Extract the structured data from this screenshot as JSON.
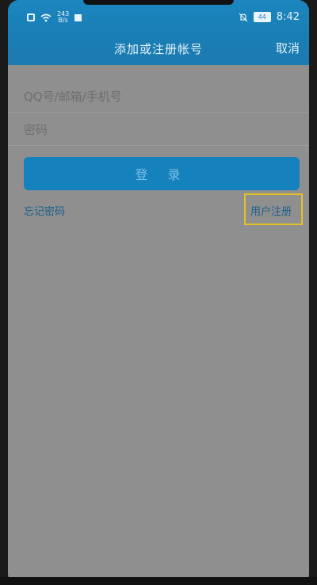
{
  "status": {
    "speed_top": "243",
    "speed_unit": "B/s",
    "battery": "44",
    "time": "8:42"
  },
  "appbar": {
    "title": "添加或注册帐号",
    "cancel": "取消"
  },
  "form": {
    "account_placeholder": "QQ号/邮箱/手机号",
    "password_placeholder": "密码",
    "login_label": "登 录",
    "forgot_password": "忘记密码",
    "register": "用户注册"
  },
  "colors": {
    "accent": "#1a7fb6",
    "highlight": "#e5c125"
  }
}
